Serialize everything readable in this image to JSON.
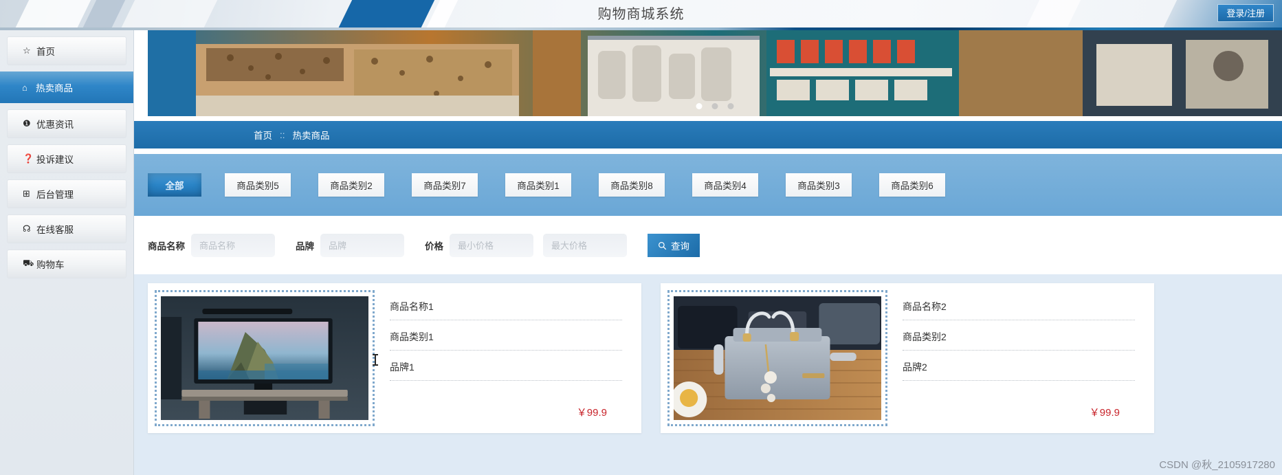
{
  "header": {
    "title": "购物商城系统",
    "login_label": "登录/注册"
  },
  "sidebar": {
    "items": [
      {
        "label": "首页",
        "icon": "star-icon",
        "glyph": "☆",
        "active": false
      },
      {
        "label": "热卖商品",
        "icon": "bag-icon",
        "glyph": "⌂",
        "active": true
      },
      {
        "label": "优惠资讯",
        "icon": "info-icon",
        "glyph": "❶",
        "active": false
      },
      {
        "label": "投诉建议",
        "icon": "question-icon",
        "glyph": "❓",
        "active": false
      },
      {
        "label": "后台管理",
        "icon": "grid-icon",
        "glyph": "⊞",
        "active": false
      },
      {
        "label": "在线客服",
        "icon": "headset-icon",
        "glyph": "☊",
        "active": false
      },
      {
        "label": "购物车",
        "icon": "cart-icon",
        "glyph": "⛟",
        "active": false
      }
    ]
  },
  "banner": {
    "slides_count": 3,
    "active_slide": 1,
    "alt": "商店内景轮播图"
  },
  "breadcrumb": {
    "home": "首页",
    "separator": "::",
    "current": "热卖商品"
  },
  "tabs": [
    {
      "label": "全部",
      "active": true
    },
    {
      "label": "商品类别5",
      "active": false
    },
    {
      "label": "商品类别2",
      "active": false
    },
    {
      "label": "商品类别7",
      "active": false
    },
    {
      "label": "商品类别1",
      "active": false
    },
    {
      "label": "商品类别8",
      "active": false
    },
    {
      "label": "商品类别4",
      "active": false
    },
    {
      "label": "商品类别3",
      "active": false
    },
    {
      "label": "商品类别6",
      "active": false
    }
  ],
  "search": {
    "name_label": "商品名称",
    "name_placeholder": "商品名称",
    "name_value": "",
    "brand_label": "品牌",
    "brand_placeholder": "品牌",
    "brand_value": "",
    "price_label": "价格",
    "price_min_placeholder": "最小价格",
    "price_min_value": "",
    "price_max_placeholder": "最大价格",
    "price_max_value": "",
    "query_label": "查询",
    "query_icon": "search-icon"
  },
  "products": [
    {
      "name": "商品名称1",
      "category": "商品类别1",
      "brand": "品牌1",
      "price": "￥99.9",
      "image_alt": "电视机商品图"
    },
    {
      "name": "商品名称2",
      "category": "商品类别2",
      "brand": "品牌2",
      "price": "￥99.9",
      "image_alt": "手提包商品图"
    }
  ],
  "watermark": "CSDN @秋_2105917280",
  "colors": {
    "accent_blue": "#1d6ca8",
    "tab_bar_blue": "#6aa7d6",
    "price_red": "#c8242b",
    "sidebar_bg": "#e9edf1"
  }
}
